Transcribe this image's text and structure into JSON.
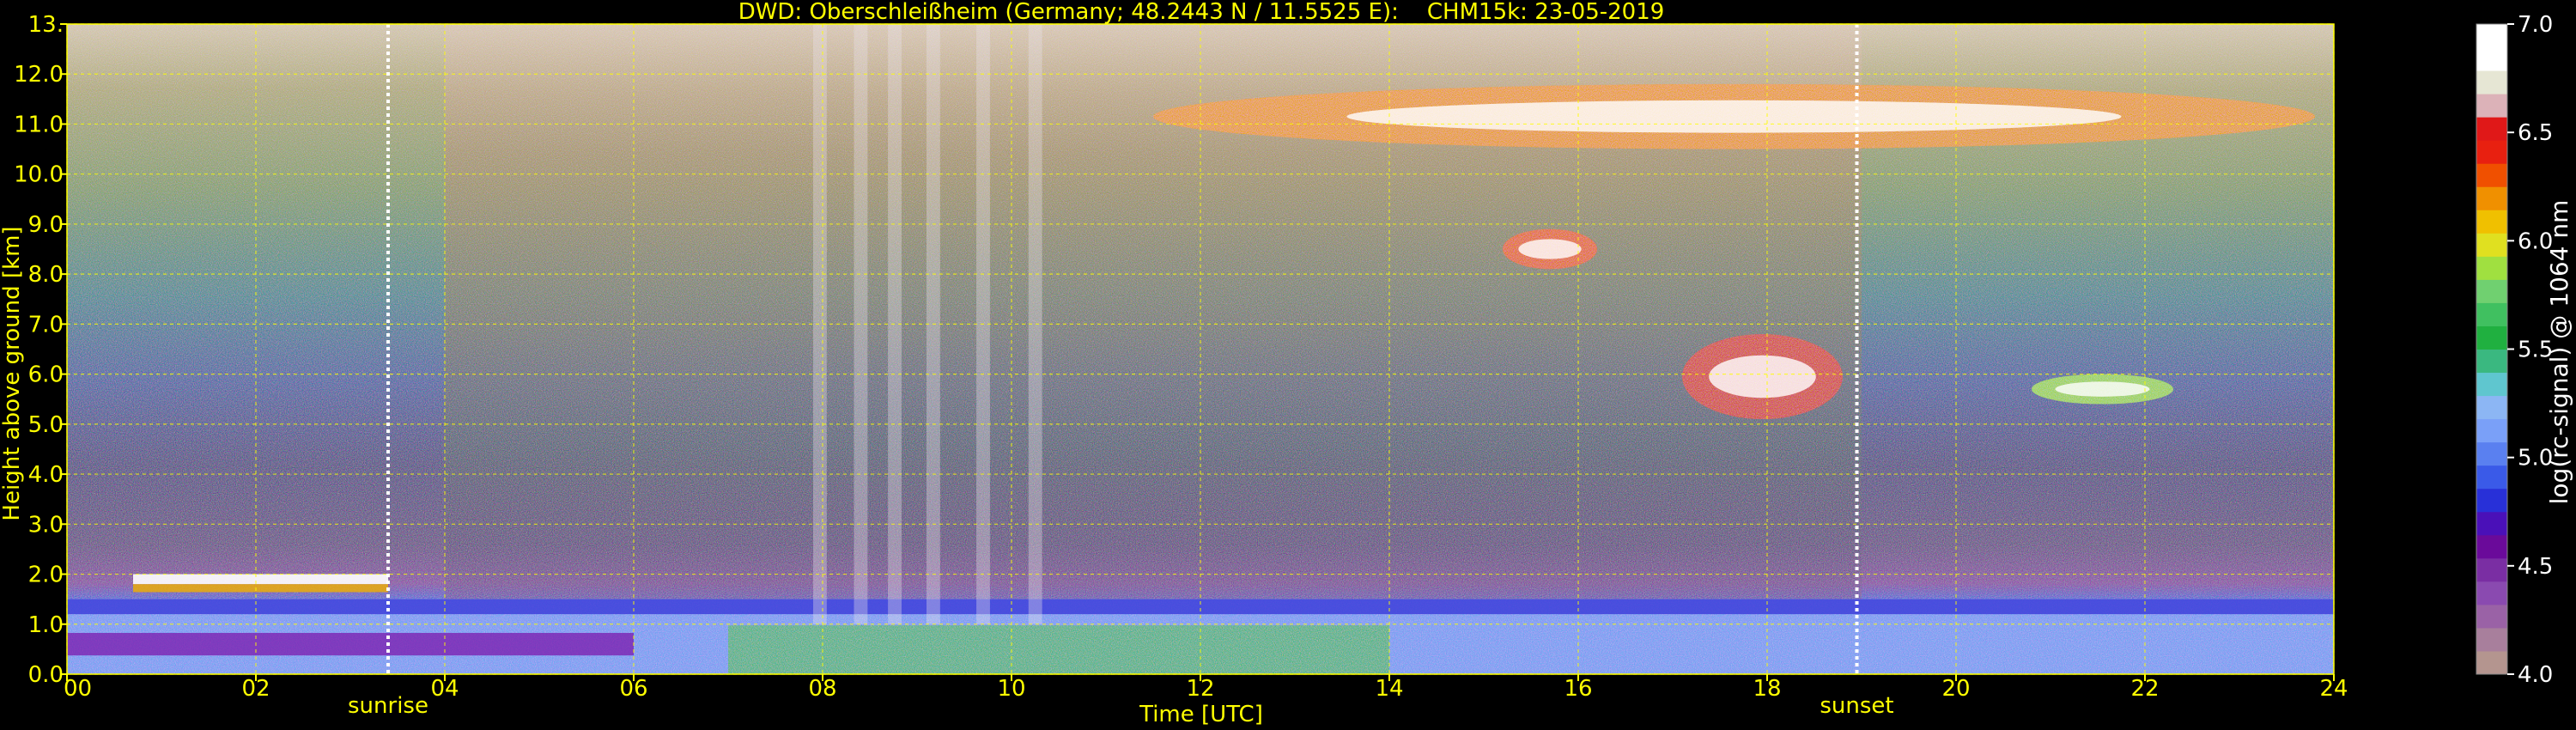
{
  "chart_data": {
    "type": "heatmap",
    "title": "DWD: Oberschleißheim (Germany; 48.2443 N / 11.5525 E):    CHM15k: 23-05-2019",
    "xlabel": "Time [UTC]",
    "ylabel": "Height above ground [km]",
    "xlim": [
      0,
      24
    ],
    "ylim": [
      0,
      13
    ],
    "x_ticks": [
      "00",
      "02",
      "04",
      "06",
      "08",
      "10",
      "12",
      "14",
      "16",
      "18",
      "20",
      "22",
      "24"
    ],
    "y_ticks": [
      "0.0",
      "1.0",
      "2.0",
      "3.0",
      "4.0",
      "5.0",
      "6.0",
      "7.0",
      "8.0",
      "9.0",
      "10.0",
      "11.0",
      "12.0",
      "13."
    ],
    "grid": true,
    "markers": [
      {
        "name": "sunrise",
        "x": 3.4
      },
      {
        "name": "sunset",
        "x": 18.95
      }
    ],
    "colorbar": {
      "label": "log(rc-signal) @ 1064 nm",
      "min": 4.0,
      "max": 7.0,
      "ticks": [
        "4.0",
        "4.5",
        "5.0",
        "5.5",
        "6.0",
        "6.5",
        "7.0"
      ],
      "colors": [
        "#b4958f",
        "#a87f9c",
        "#9a62a6",
        "#8a4ab0",
        "#7a2ea3",
        "#6a0a9a",
        "#4a10b8",
        "#2830d8",
        "#3a5ae8",
        "#5a80f0",
        "#7aa0f8",
        "#8cb6f4",
        "#5fc6cf",
        "#3ab880",
        "#20b040",
        "#40c060",
        "#70d070",
        "#a0e040",
        "#e0e020",
        "#f0c000",
        "#f09000",
        "#f05000",
        "#e82010",
        "#e01818",
        "#dcb2b8",
        "#e6e6d4",
        "#ffffff",
        "#ffffff"
      ]
    },
    "features": [
      {
        "type": "boundary_layer",
        "x_range": [
          0,
          24
        ],
        "height_km": [
          0,
          1.5
        ],
        "level": 5.2
      },
      {
        "type": "residual_layer",
        "x_range": [
          0.7,
          3.4
        ],
        "height_km": [
          1.8,
          2.0
        ],
        "level": 6.5
      },
      {
        "type": "cirrus",
        "x_range": [
          11.5,
          23.8
        ],
        "height_km": [
          10.5,
          11.8
        ],
        "level": 6.2
      },
      {
        "type": "cloud",
        "x_range": [
          15.2,
          16.2
        ],
        "height_km": [
          8.1,
          8.9
        ],
        "level": 6.3
      },
      {
        "type": "cloud",
        "x_range": [
          17.1,
          18.8
        ],
        "height_km": [
          5.1,
          6.8
        ],
        "level": 6.5
      },
      {
        "type": "cloud",
        "x_range": [
          20.8,
          22.3
        ],
        "height_km": [
          5.4,
          6.0
        ],
        "level": 5.9
      },
      {
        "type": "precipitation_streaks",
        "x_range": [
          7.9,
          10.3
        ],
        "height_km": [
          1.0,
          13.0
        ],
        "level": 6.0
      }
    ]
  }
}
